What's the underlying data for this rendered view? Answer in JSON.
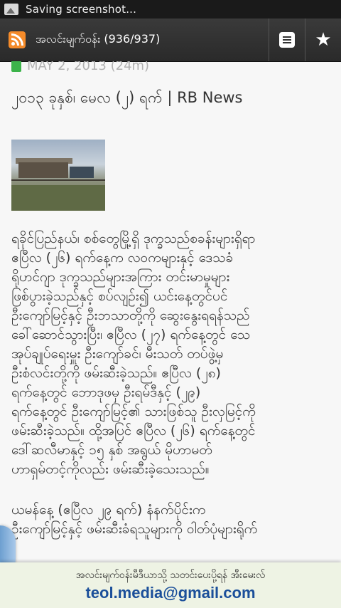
{
  "status_bar": {
    "notification": "Saving screenshot..."
  },
  "toolbar": {
    "title": "အလင်းမျက်ဝန်း (936/937)",
    "icons": {
      "feed": "rss-icon",
      "list": "list-icon",
      "favorite": "star-icon"
    }
  },
  "article": {
    "date": "MAY 2, 2013 (24m)",
    "title": "၂၀၁၃ ခုနှစ်၊ မေလ (၂) ရက် | RB News",
    "paragraph1": [
      "ရခိုင်ပြည်နယ်၊ စစ်တွေမြို့ရှိ ဒုက္ခသည်စခန်းများရှိရာ",
      "ဧပြီလ (၂၆) ရက်နေ့က လဝကများနှင့် ဒေသခံ",
      "ရိုဟင်ဂျာ ဒုက္ခသည်များအကြား တင်းမာမှုများ",
      "ဖြစ်ပွားခဲ့သည်နှင့် စပ်လျဉ်း၍ ယင်းနေ့တွင်ပင်",
      "ဦးကျော်မြင့်နှင့် ဦးဘသာတို့ကို ဆွေးနွေးရရန်သည်",
      "ခေါ်ဆောင်သွားပြီး၊ ဧပြီလ (၂၇) ရက်နေ့တွင် သေ",
      "အုပ်ချုပ်ရေးမှူး ဦးကျော်ခင်၊ မီးသတ် တပ်ဖွဲ့မှ",
      "ဦးစံလင်းတို့ကို ဖမ်းဆီးခဲ့သည်။ ဧပြီလ (၂၈)",
      "ရက်နေ့တွင် ဘောဒုဖမှ ဦးရမ်ဒီနှင့် (၂၉)",
      "ရက်နေ့တွင် ဦးကျော်မြင့်၏ သားဖြစ်သူ ဦးလှမြင့်ကို",
      "ဖမ်းဆီးခဲ့သည်။ ထို့အပြင် ဧပြီလ (၂၆) ရက်နေ့တွင်",
      "ဒေါ်ဆလီမာနှင့် ၁၅ နှစ် အရွယ် မိုဟာမတ်",
      "ဟာရှမ်တင့်ကိုလည်း ဖမ်းဆီးခဲ့သေးသည်။"
    ],
    "paragraph2": [
      "ယမန်နေ့ (ဧပြီလ ၂၉ ရက်) နံနက်ပိုင်းက",
      "ဦးကျော်မြင့်နှင့် ဖမ်းဆီးခံရသူများကို ဝါတ်ပုံများရိုက်"
    ]
  },
  "banner": {
    "line1": "အလင်းမျက်ဝန်းမီဒီယာသို့ သတင်းပေးပို့ရန် အီးမေးလ်",
    "email": "teol.media@gmail.com"
  }
}
